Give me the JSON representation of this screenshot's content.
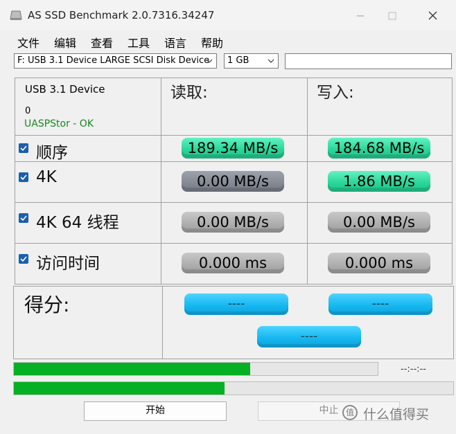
{
  "window": {
    "title": "AS SSD Benchmark 2.0.7316.34247"
  },
  "menu": [
    "文件",
    "编辑",
    "查看",
    "工具",
    "语言",
    "帮助"
  ],
  "toolbar": {
    "device_select": "F: USB 3.1 Device LARGE SCSI Disk Device",
    "size_select": "1 GB",
    "extra_field": ""
  },
  "device_info": {
    "name": "USB 3.1 Device",
    "number": "0",
    "status": "UASPStor - OK"
  },
  "columns": {
    "read": "读取:",
    "write": "写入:"
  },
  "rows": [
    {
      "label": "顺序",
      "checked": true,
      "read": "189.34 MB/s",
      "write": "184.68 MB/s"
    },
    {
      "label": "4K",
      "checked": true,
      "read": "0.00 MB/s",
      "write": "1.86 MB/s"
    },
    {
      "label": "4K 64 线程",
      "checked": true,
      "read": "0.00 MB/s",
      "write": "0.00 MB/s"
    },
    {
      "label": "访问时间",
      "checked": true,
      "read": "0.000 ms",
      "write": "0.000 ms"
    }
  ],
  "score": {
    "label": "得分:",
    "read": "----",
    "write": "----",
    "total": "----"
  },
  "progress": {
    "bar1": 0.65,
    "bar2": 0.48,
    "elapsed": "--:--:--"
  },
  "buttons": {
    "start": "开始",
    "stop": "中止"
  },
  "watermark": {
    "icon_text": "值",
    "text": "什么值得买"
  },
  "colors": {
    "green_value": "#2bd79b",
    "gray_value": "#b0b0b0",
    "score_blue": "#16b8f2",
    "progress_green": "#06b025",
    "status_green": "#17881f"
  }
}
